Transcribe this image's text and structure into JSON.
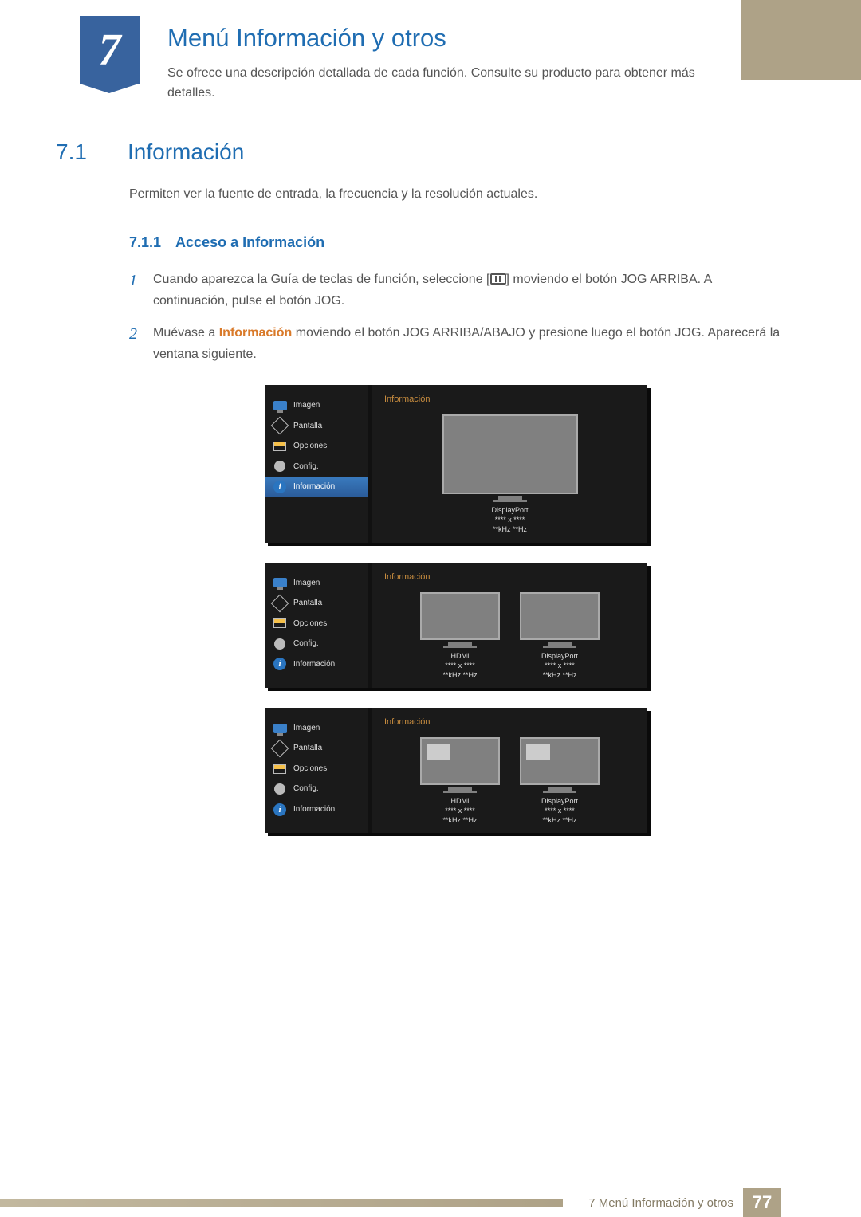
{
  "chapter": {
    "number": "7",
    "title": "Menú Información y otros",
    "subtitle": "Se ofrece una descripción detallada de cada función. Consulte su producto para obtener más detalles."
  },
  "section": {
    "number": "7.1",
    "title": "Información",
    "intro": "Permiten ver la fuente de entrada, la frecuencia y la resolución actuales."
  },
  "subsection": {
    "number": "7.1.1",
    "title": "Acceso a Información"
  },
  "steps": {
    "s1_num": "1",
    "s1_a": "Cuando aparezca la Guía de teclas de función, seleccione [",
    "s1_b": "] moviendo el botón JOG ARRIBA. A continuación, pulse el botón JOG.",
    "s2_num": "2",
    "s2_a": "Muévase a ",
    "s2_hl": "Información",
    "s2_b": " moviendo el botón JOG ARRIBA/ABAJO y presione luego el botón JOG. Aparecerá la ventana siguiente."
  },
  "osd": {
    "menu": {
      "imagen": "Imagen",
      "pantalla": "Pantalla",
      "opciones": "Opciones",
      "config": "Config.",
      "informacion": "Información"
    },
    "right_title": "Información",
    "source_hdmi": "HDMI",
    "source_dp": "DisplayPort",
    "res": "**** x ****",
    "freq": "**kHz **Hz",
    "info_i": "i"
  },
  "footer": {
    "text": "7 Menú Información y otros",
    "page": "77"
  }
}
